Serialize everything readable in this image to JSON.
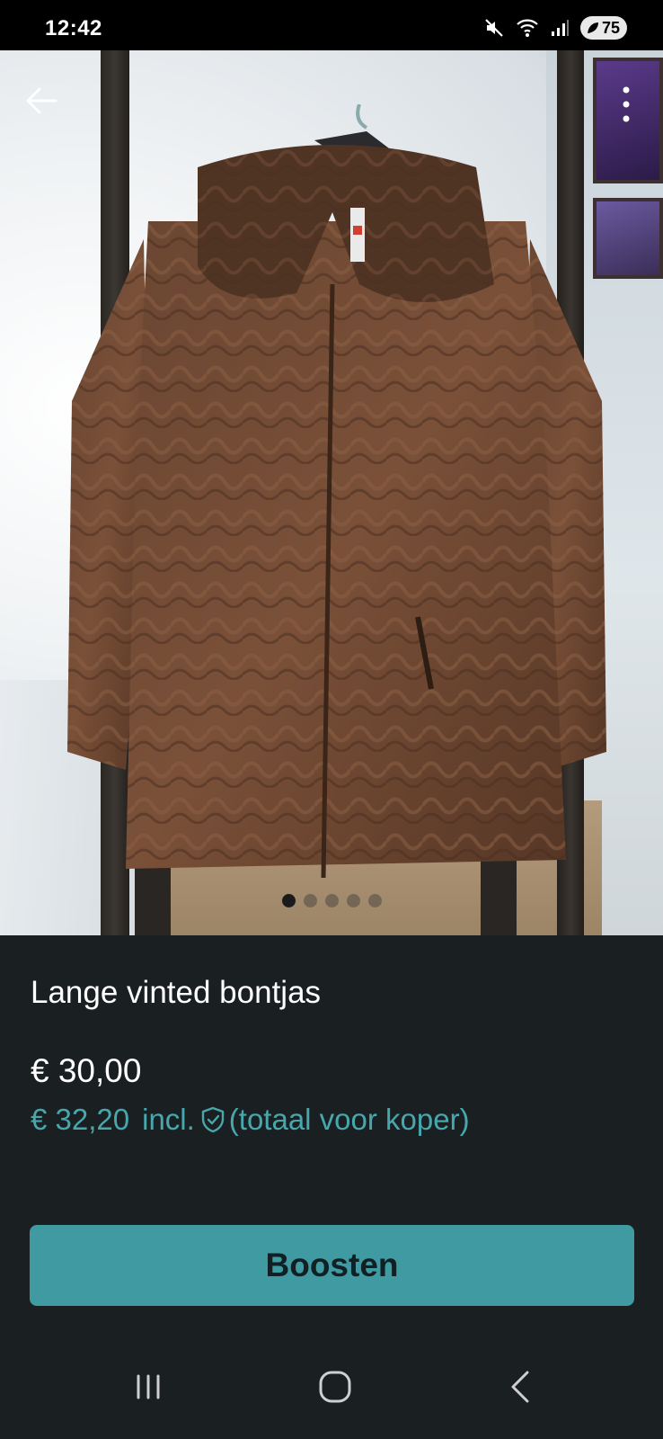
{
  "status_bar": {
    "time": "12:42",
    "battery": "75",
    "icons": [
      "mute-icon",
      "wifi-icon",
      "signal-icon",
      "battery-icon"
    ]
  },
  "gallery": {
    "image_alt": "Lange vinted bontjas",
    "dot_count": 5,
    "active_dot_index": 0
  },
  "listing": {
    "title": "Lange vinted bontjas",
    "price": "€ 30,00",
    "total_price": "€ 32,20",
    "incl_label": "incl.",
    "total_note": "(totaal voor koper)"
  },
  "actions": {
    "boost_label": "Boosten"
  },
  "nav": {
    "items": [
      "recent-apps-icon",
      "home-icon",
      "back-icon"
    ]
  },
  "colors": {
    "background": "#1a1f22",
    "accent": "#48a7ac",
    "button": "#3f9aa1"
  }
}
